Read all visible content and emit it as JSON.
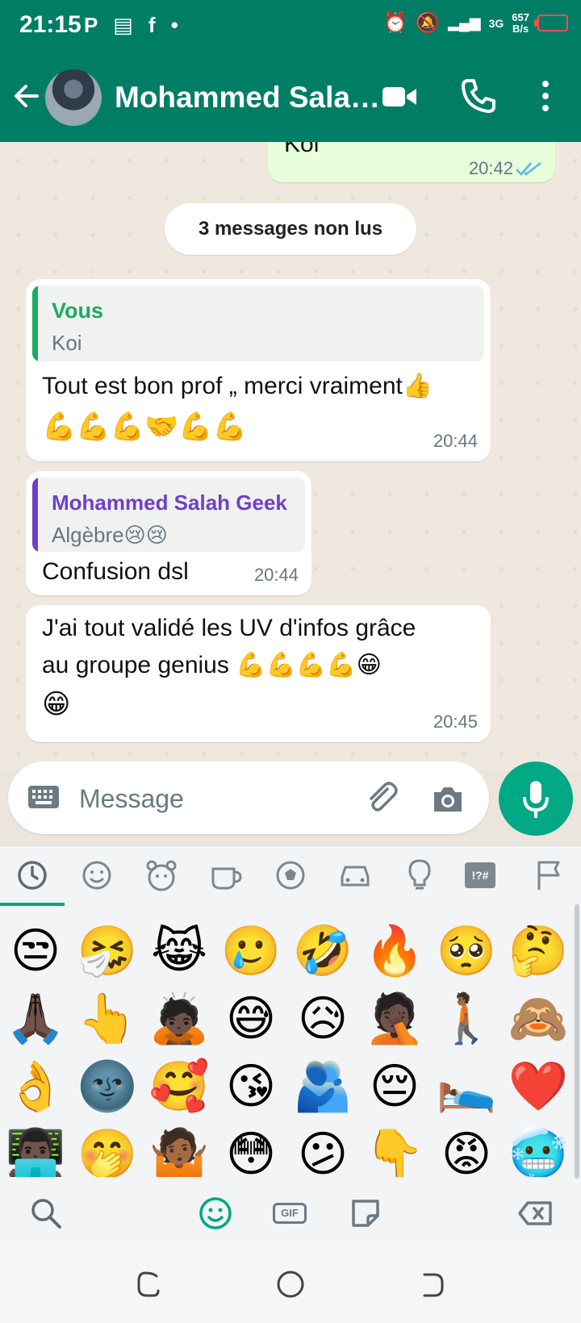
{
  "status_bar": {
    "time": "21:15",
    "left_icons": "P ▤ f •",
    "signal_label": "3G",
    "net_rate_value": "657",
    "net_rate_unit": "B/s"
  },
  "header": {
    "contact_name": "Mohammed Sala…"
  },
  "messages": {
    "outgoing_top": {
      "text": "Koi",
      "time": "20:42"
    },
    "unread_banner": "3 messages non lus",
    "msg1": {
      "quote_author": "Vous",
      "quote_text": "Koi",
      "line1": "Tout est bon prof „ merci vraiment👍",
      "line2": "💪💪💪🤝💪💪",
      "time": "20:44"
    },
    "msg2": {
      "quote_author": "Mohammed Salah Geek",
      "quote_text": "Algèbre😢😢",
      "text": "Confusion dsl",
      "time": "20:44"
    },
    "msg3": {
      "line1": "J'ai tout validé les UV d'infos grâce",
      "line2": "au groupe genius 💪💪💪💪😁",
      "line3": "😁",
      "time": "20:45"
    }
  },
  "composer": {
    "placeholder": "Message"
  },
  "emoji_keyboard": {
    "categories": [
      "recent",
      "smileys",
      "animals",
      "food",
      "activities",
      "travel",
      "objects",
      "symbols",
      "flags"
    ],
    "symbols_label": "!?#",
    "rows": [
      [
        "😒",
        "🤧",
        "😹",
        "🥲",
        "🤣",
        "🔥",
        "🥺",
        "🤔"
      ],
      [
        "🙏🏿",
        "👆",
        "🙇🏿",
        "😅",
        "😥",
        "🤦🏿",
        "🚶🏾",
        "🙈"
      ],
      [
        "👌",
        "🌚",
        "🥰",
        "😘",
        "🫂",
        "😔",
        "🛌",
        "❤️"
      ],
      [
        "👨🏿‍💻",
        "🤭",
        "🤷🏾",
        "😳",
        "😕",
        "👇",
        "😡",
        "🥶"
      ]
    ],
    "gif_label": "GIF"
  },
  "colors": {
    "header": "#007D65",
    "accent": "#00A884",
    "outgoing_bubble": "#E7FFDB",
    "quote_self": "#1DAA61",
    "quote_other": "#6E40C9",
    "tick_read": "#53BDEB"
  }
}
